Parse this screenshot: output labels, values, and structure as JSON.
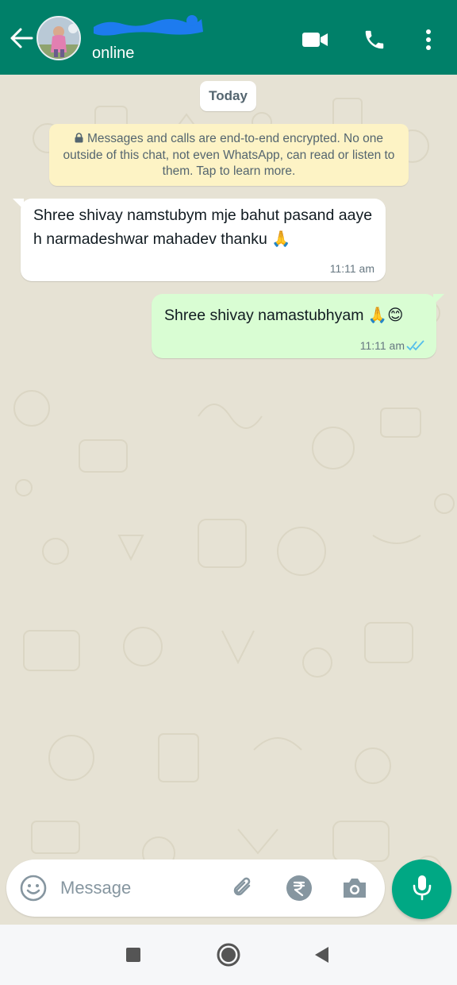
{
  "header": {
    "contact_status": "online",
    "icons": [
      "back-arrow-icon",
      "video-call-icon",
      "phone-icon",
      "more-vert-icon"
    ],
    "color": "#008069"
  },
  "chat": {
    "date_chip": "Today",
    "encryption_notice": "Messages and calls are end-to-end encrypted. No one outside of this chat, not even WhatsApp, can read or listen to them. Tap to learn more.",
    "messages": [
      {
        "direction": "incoming",
        "text": "Shree shivay namstubym mje bahut pasand aaye h narmadeshwar mahadev thanku 🙏",
        "time": "11:11 am"
      },
      {
        "direction": "outgoing",
        "text": "Shree shivay namastubhyam 🙏😊",
        "time": "11:11 am",
        "read": true
      }
    ],
    "background_color": "#e6e2d4",
    "outgoing_bubble_color": "#d9fdd3",
    "notice_color": "#fdf3c5"
  },
  "composer": {
    "placeholder": "Message",
    "icons": [
      "emoji-icon",
      "attach-icon",
      "rupee-payment-icon",
      "camera-icon",
      "mic-icon"
    ],
    "accent": "#00a884"
  },
  "system_nav": {
    "icons": [
      "recents-square-icon",
      "home-circle-icon",
      "back-triangle-icon"
    ]
  }
}
